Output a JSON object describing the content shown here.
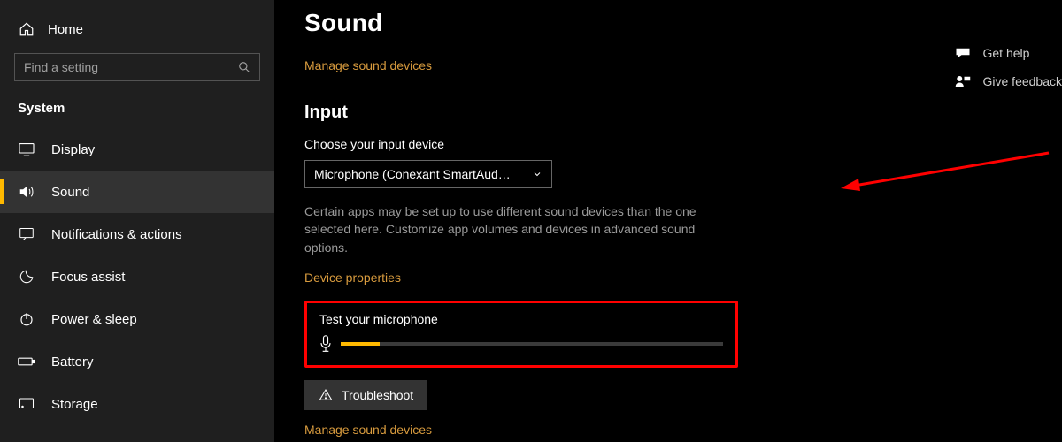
{
  "sidebar": {
    "home": "Home",
    "search_placeholder": "Find a setting",
    "section": "System",
    "items": [
      {
        "label": "Display"
      },
      {
        "label": "Sound"
      },
      {
        "label": "Notifications & actions"
      },
      {
        "label": "Focus assist"
      },
      {
        "label": "Power & sleep"
      },
      {
        "label": "Battery"
      },
      {
        "label": "Storage"
      }
    ]
  },
  "main": {
    "title": "Sound",
    "manage_link": "Manage sound devices",
    "input_heading": "Input",
    "choose_label": "Choose your input device",
    "dropdown_value": "Microphone (Conexant SmartAud…",
    "info_text": "Certain apps may be set up to use different sound devices than the one selected here. Customize app volumes and devices in advanced sound options.",
    "device_props": "Device properties",
    "test_label": "Test your microphone",
    "troubleshoot": "Troubleshoot",
    "manage_link2": "Manage sound devices"
  },
  "help": {
    "get_help": "Get help",
    "feedback": "Give feedback"
  }
}
